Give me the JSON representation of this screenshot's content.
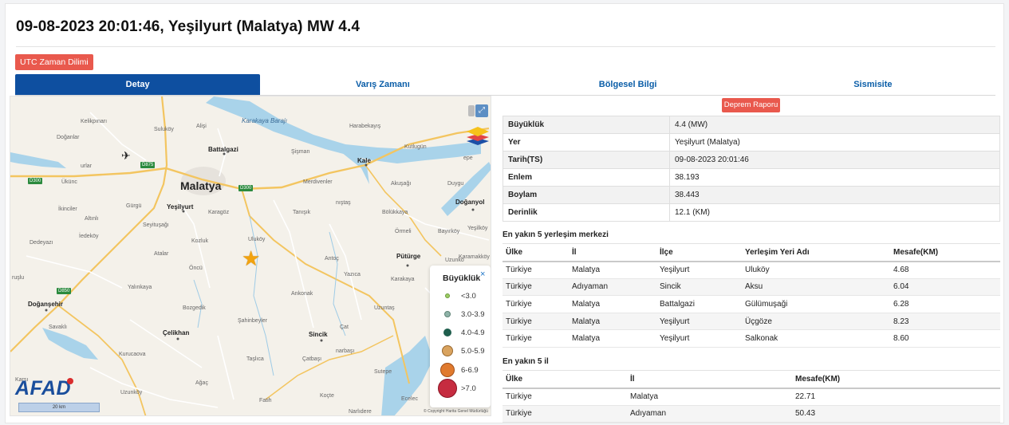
{
  "header": {
    "title": "09-08-2023 20:01:46, Yeşilyurt (Malatya) MW 4.4",
    "utc_button": "UTC Zaman Dilimi"
  },
  "tabs": [
    "Detay",
    "Varış Zamanı",
    "Bölgesel Bilgi",
    "Sismisite"
  ],
  "report_button": "Deprem Raporu",
  "info": [
    {
      "key": "Büyüklük",
      "value": "4.4 (MW)"
    },
    {
      "key": "Yer",
      "value": "Yeşilyurt (Malatya)"
    },
    {
      "key": "Tarih(TS)",
      "value": "09-08-2023 20:01:46"
    },
    {
      "key": "Enlem",
      "value": "38.193"
    },
    {
      "key": "Boylam",
      "value": "38.443"
    },
    {
      "key": "Derinlik",
      "value": "12.1 (KM)"
    }
  ],
  "settlements": {
    "title": "En yakın 5 yerleşim merkezi",
    "columns": [
      "Ülke",
      "İl",
      "İlçe",
      "Yerleşim Yeri Adı",
      "Mesafe(KM)"
    ],
    "rows": [
      [
        "Türkiye",
        "Malatya",
        "Yeşilyurt",
        "Uluköy",
        "4.68"
      ],
      [
        "Türkiye",
        "Adıyaman",
        "Sincik",
        "Aksu",
        "6.04"
      ],
      [
        "Türkiye",
        "Malatya",
        "Battalgazi",
        "Gülümuşaği",
        "6.28"
      ],
      [
        "Türkiye",
        "Malatya",
        "Yeşilyurt",
        "Üçgöze",
        "8.23"
      ],
      [
        "Türkiye",
        "Malatya",
        "Yeşilyurt",
        "Salkonak",
        "8.60"
      ]
    ]
  },
  "provinces": {
    "title": "En yakın 5 il",
    "columns": [
      "Ülke",
      "İl",
      "Mesafe(KM)"
    ],
    "rows": [
      [
        "Türkiye",
        "Malatya",
        "22.71"
      ],
      [
        "Türkiye",
        "Adıyaman",
        "50.43"
      ]
    ]
  },
  "legend": {
    "title": "Büyüklük",
    "close": "×",
    "items": [
      {
        "label": "<3.0",
        "color": "#9ccc65"
      },
      {
        "label": "3.0-3.9",
        "color": "#8fb3a8"
      },
      {
        "label": "4.0-4.9",
        "color": "#1f5e4d"
      },
      {
        "label": "5.0-5.9",
        "color": "#d9a35f"
      },
      {
        "label": "6-6.9",
        "color": "#e07a2e"
      },
      {
        "label": ">7.0",
        "color": "#c62c40"
      }
    ]
  },
  "map": {
    "logo": "AFAD",
    "scale": "20 km",
    "copyright": "© Copyright Harita Genel Müdürlüğü",
    "icons": {
      "marker": "star-icon",
      "airport": "plane-icon",
      "layers": "layers-icon",
      "expand": "expand-icon"
    },
    "labels": [
      {
        "text": "Malatya",
        "cls": "big"
      },
      {
        "text": "Karakaya Barajı",
        "cls": "water"
      },
      {
        "text": "Battalgazi",
        "cls": "city"
      },
      {
        "text": "Yeşilyurt",
        "cls": "city"
      },
      {
        "text": "Kale",
        "cls": "city"
      },
      {
        "text": "Doğanyol",
        "cls": "city"
      },
      {
        "text": "Pütürge",
        "cls": "city"
      },
      {
        "text": "Doğanşehir",
        "cls": "city"
      },
      {
        "text": "Çelikhan",
        "cls": "city"
      },
      {
        "text": "Sincik",
        "cls": "city"
      },
      {
        "text": "Kelikpınarı",
        "cls": ""
      },
      {
        "text": "Suluköy",
        "cls": ""
      },
      {
        "text": "Alişi",
        "cls": ""
      },
      {
        "text": "Harabekayış",
        "cls": ""
      },
      {
        "text": "Doğanlar",
        "cls": ""
      },
      {
        "text": "Şişman",
        "cls": ""
      },
      {
        "text": "Kutlugün",
        "cls": ""
      },
      {
        "text": "epe",
        "cls": ""
      },
      {
        "text": "urlar",
        "cls": ""
      },
      {
        "text": "Ükünc",
        "cls": ""
      },
      {
        "text": "Gürgü",
        "cls": ""
      },
      {
        "text": "Karagöz",
        "cls": ""
      },
      {
        "text": "Merdivenler",
        "cls": ""
      },
      {
        "text": "Akuşağı",
        "cls": ""
      },
      {
        "text": "Duygu",
        "cls": ""
      },
      {
        "text": "İkinciler",
        "cls": ""
      },
      {
        "text": "Altınlı",
        "cls": ""
      },
      {
        "text": "Seyituşağı",
        "cls": ""
      },
      {
        "text": "Tanışık",
        "cls": ""
      },
      {
        "text": "nıştaş",
        "cls": ""
      },
      {
        "text": "Bölükkaya",
        "cls": ""
      },
      {
        "text": "Dedeyazı",
        "cls": ""
      },
      {
        "text": "İedeköy",
        "cls": ""
      },
      {
        "text": "Kozluk",
        "cls": ""
      },
      {
        "text": "Uluköy",
        "cls": ""
      },
      {
        "text": "Örmeli",
        "cls": ""
      },
      {
        "text": "Bayırköy",
        "cls": ""
      },
      {
        "text": "Yeşilköy",
        "cls": ""
      },
      {
        "text": "Atalar",
        "cls": ""
      },
      {
        "text": "Antoç",
        "cls": ""
      },
      {
        "text": "Uzunko",
        "cls": ""
      },
      {
        "text": "Öncü",
        "cls": ""
      },
      {
        "text": "Yazıca",
        "cls": ""
      },
      {
        "text": "Karakaya",
        "cls": ""
      },
      {
        "text": "Yalınkaya",
        "cls": ""
      },
      {
        "text": "Ankonak",
        "cls": ""
      },
      {
        "text": "Bozgedik",
        "cls": ""
      },
      {
        "text": "Uzuntaş",
        "cls": ""
      },
      {
        "text": "Şahinbeyler",
        "cls": ""
      },
      {
        "text": "Savaklı",
        "cls": ""
      },
      {
        "text": "Çat",
        "cls": ""
      },
      {
        "text": "Kurucaova",
        "cls": ""
      },
      {
        "text": "narbaşı",
        "cls": ""
      },
      {
        "text": "Taşlıca",
        "cls": ""
      },
      {
        "text": "Çatbaşı",
        "cls": ""
      },
      {
        "text": "Sutepe",
        "cls": ""
      },
      {
        "text": "Uzunköy",
        "cls": ""
      },
      {
        "text": "Ağaç",
        "cls": ""
      },
      {
        "text": "Fatih",
        "cls": ""
      },
      {
        "text": "Koçte",
        "cls": ""
      },
      {
        "text": "Ecelec",
        "cls": ""
      },
      {
        "text": "Narlıdere",
        "cls": ""
      },
      {
        "text": "Karşı",
        "cls": ""
      },
      {
        "text": "ruşlu",
        "cls": ""
      },
      {
        "text": "Karamakköy",
        "cls": ""
      }
    ],
    "roads": [
      "D875",
      "D300",
      "D300",
      "D850"
    ]
  }
}
